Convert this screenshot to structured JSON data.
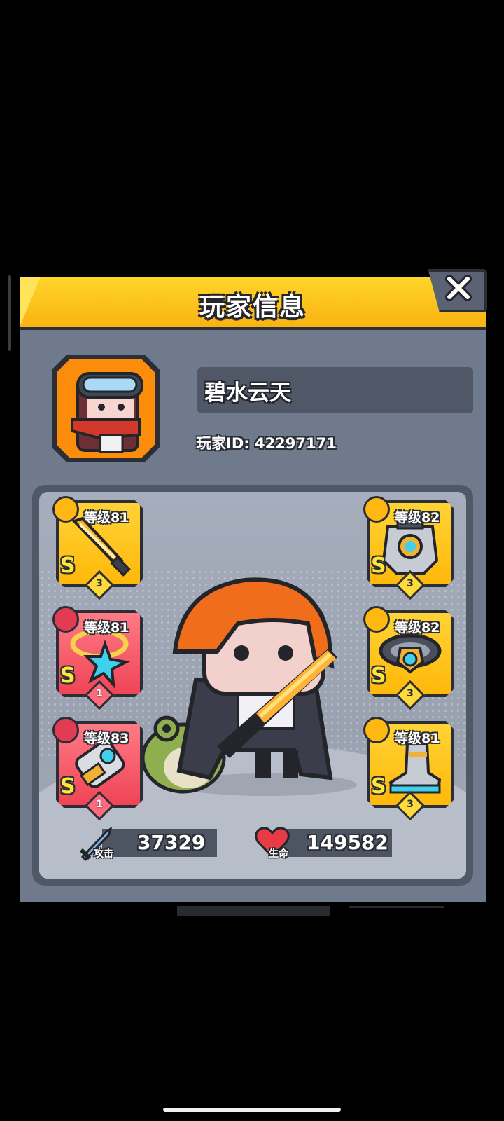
{
  "modal": {
    "title": "玩家信息",
    "close_icon": "close-icon"
  },
  "player": {
    "name": "碧水云天",
    "id_label": "玩家ID: 42297171",
    "avatar_icon": "player-avatar-icon"
  },
  "equipment": {
    "weapon": {
      "level": "等级81",
      "grade": "S",
      "stars": "3",
      "icon": "sword-icon",
      "badge_icon": "weapon-category-icon",
      "rarity": "gold"
    },
    "necklace": {
      "level": "等级81",
      "grade": "S",
      "stars": "1",
      "icon": "star-necklace-icon",
      "badge_icon": "necklace-category-icon",
      "rarity": "red"
    },
    "gloves": {
      "level": "等级83",
      "grade": "S",
      "stars": "1",
      "icon": "gauntlet-icon",
      "badge_icon": "glove-category-icon",
      "rarity": "red"
    },
    "armor": {
      "level": "等级82",
      "grade": "S",
      "stars": "3",
      "icon": "armor-icon",
      "badge_icon": "armor-category-icon",
      "rarity": "gold"
    },
    "belt": {
      "level": "等级82",
      "grade": "S",
      "stars": "3",
      "icon": "belt-icon",
      "badge_icon": "belt-category-icon",
      "rarity": "gold"
    },
    "boots": {
      "level": "等级81",
      "grade": "S",
      "stars": "3",
      "icon": "boots-icon",
      "badge_icon": "boots-category-icon",
      "rarity": "gold"
    }
  },
  "stats": {
    "attack": {
      "label": "攻击",
      "value": "37329",
      "icon": "sword-stat-icon"
    },
    "health": {
      "label": "生命",
      "value": "149582",
      "icon": "heart-icon"
    }
  },
  "colors": {
    "header": "#ffc71f",
    "panel": "#6f7a8d",
    "gold_slot": "#ffc21a",
    "red_slot": "#f45566"
  }
}
